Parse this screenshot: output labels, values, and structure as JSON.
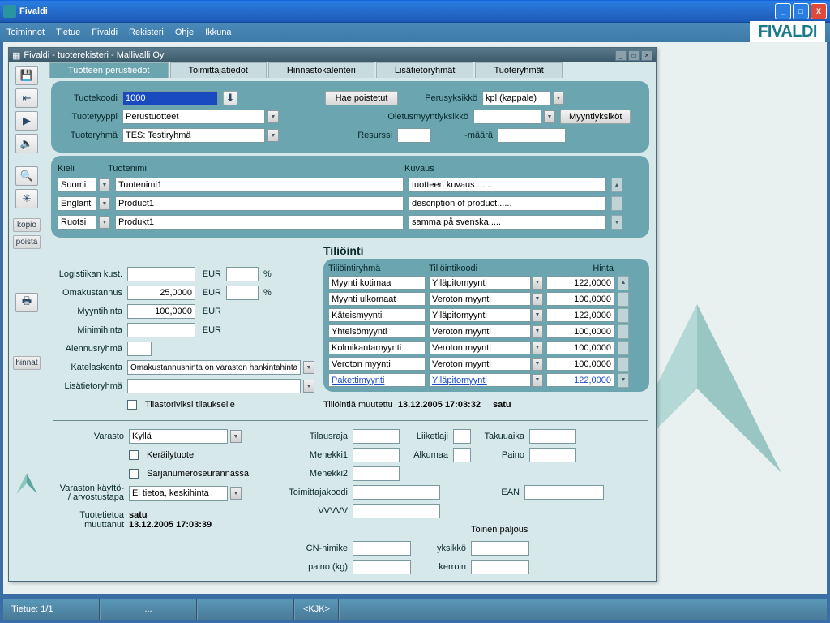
{
  "outer_title": "Fivaldi",
  "app_brand": "FIVALDI",
  "menu": [
    "Toiminnot",
    "Tietue",
    "Fivaldi",
    "Rekisteri",
    "Ohje",
    "Ikkuna"
  ],
  "inner_title": "Fivaldi - tuoterekisteri - Mallivalli Oy",
  "left_toolbar": {
    "kopio": "kopio",
    "poista": "poista",
    "hinnat": "hinnat"
  },
  "tabs": [
    "Tuotteen perustiedot",
    "Toimittajatiedot",
    "Hinnastokalenteri",
    "Lisätietoryhmät",
    "Tuoteryhmät"
  ],
  "top": {
    "tuotekoodi_lbl": "Tuotekoodi",
    "tuotekoodi_val": "1000",
    "hae_poistetut": "Hae poistetut",
    "perusyksikko_lbl": "Perusyksikkö",
    "perusyksikko_val": "kpl (kappale)",
    "tuotetyyppi_lbl": "Tuotetyyppi",
    "tuotetyyppi_val": "Perustuotteet",
    "oletusmyyntiyksikko_lbl": "Oletusmyyntiyksikkö",
    "myyntiyksikot_btn": "Myyntiyksiköt",
    "tuoteryhma_lbl": "Tuoteryhmä",
    "tuoteryhma_val": "TES: Testiryhmä",
    "resurssi_lbl": "Resurssi",
    "maara_lbl": "-määrä"
  },
  "lang": {
    "kieli_hdr": "Kieli",
    "tuotenimi_hdr": "Tuotenimi",
    "kuvaus_hdr": "Kuvaus",
    "rows": [
      {
        "lang": "Suomi",
        "name": "Tuotenimi1",
        "desc": "tuotteen kuvaus ......"
      },
      {
        "lang": "Englanti",
        "name": "Product1",
        "desc": "description of product......"
      },
      {
        "lang": "Ruotsi",
        "name": "Produkt1",
        "desc": "samma på svenska....."
      }
    ]
  },
  "prices": {
    "logistiikan_kust": "Logistiikan kust.",
    "omakustannus_lbl": "Omakustannus",
    "omakustannus_val": "25,0000",
    "eur": "EUR",
    "pct": "%",
    "myyntihinta_lbl": "Myyntihinta",
    "myyntihinta_val": "100,0000",
    "minimihinta_lbl": "Minimihinta",
    "alennusryhma_lbl": "Alennusryhmä",
    "katelaskenta_lbl": "Katelaskenta",
    "katelaskenta_val": "Omakustannushinta on varaston hankintahinta",
    "lisatietoryhma_lbl": "Lisätietoryhmä",
    "tilastoriviksi": "Tilastoriviksi tilaukselle"
  },
  "tili": {
    "hdr": "Tiliöinti",
    "col_ryhma": "Tiliöintiryhmä",
    "col_koodi": "Tiliöintikoodi",
    "col_hinta": "Hinta",
    "rows": [
      {
        "g": "Myynti kotimaa",
        "k": "Ylläpitomyynti",
        "h": "122,0000"
      },
      {
        "g": "Myynti ulkomaat",
        "k": "Veroton myynti",
        "h": "100,0000"
      },
      {
        "g": "Käteismyynti",
        "k": "Ylläpitomyynti",
        "h": "122,0000"
      },
      {
        "g": "Yhteisömyynti",
        "k": "Veroton myynti",
        "h": "100,0000"
      },
      {
        "g": "Kolmikantamyynti",
        "k": "Veroton myynti",
        "h": "100,0000"
      },
      {
        "g": "Veroton myynti",
        "k": "Veroton myynti",
        "h": "100,0000"
      },
      {
        "g": "Pakettimyynti",
        "k": "Ylläpitomyynti",
        "h": "122,0000",
        "link": true
      }
    ],
    "muutettu_lbl": "Tiliöintiä muutettu",
    "muutettu_ts": "13.12.2005 17:03:32",
    "muutettu_user": "satu"
  },
  "varasto": {
    "varasto_lbl": "Varasto",
    "varasto_val": "Kyllä",
    "kerailytuote": "Keräilytuote",
    "sarjanumero": "Sarjanumeroseurannassa",
    "kaytto_lbl1": "Varaston käyttö-",
    "kaytto_lbl2": "/ arvostustapa",
    "kaytto_val": "Ei tietoa, keskihinta",
    "tuotetietoa_lbl": "Tuotetietoa",
    "muuttanut_lbl": "muuttanut",
    "muuttanut_user": "satu",
    "muuttanut_ts": "13.12.2005 17:03:39"
  },
  "misc": {
    "tilausraja": "Tilausraja",
    "menekki1": "Menekki1",
    "menekki2": "Menekki2",
    "toimittajakoodi": "Toimittajakoodi",
    "vvvvv": "VVVVV",
    "liiketlaji": "Liiketlaji",
    "alkumaa": "Alkumaa",
    "takuuaika": "Takuuaika",
    "paino": "Paino",
    "ean": "EAN",
    "toinen_paljous": "Toinen paljous",
    "cn_nimike": "CN-nimike",
    "paino_kg": "paino (kg)",
    "yksikko": "yksikkö",
    "kerroin": "kerroin"
  },
  "status": {
    "tietue": "Tietue: 1/1",
    "dots": "...",
    "kjk": "<KJK>"
  }
}
